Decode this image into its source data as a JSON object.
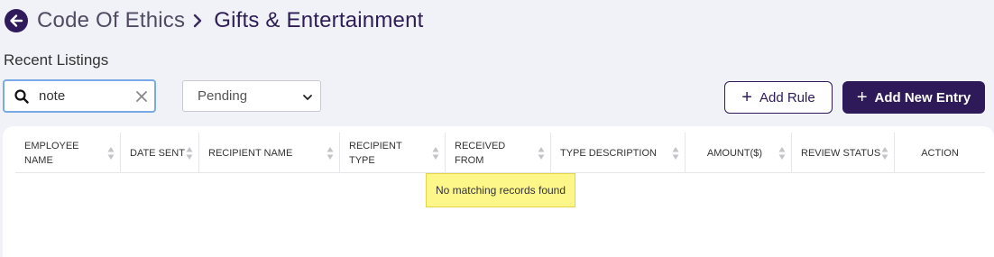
{
  "header": {
    "parent": "Code Of Ethics",
    "current": "Gifts & Entertainment"
  },
  "section_title": "Recent Listings",
  "filters": {
    "search_value": "note",
    "status_selected": "Pending"
  },
  "buttons": {
    "add_rule": "Add Rule",
    "add_new_entry": "Add New Entry"
  },
  "table": {
    "columns": [
      {
        "label": "EMPLOYEE NAME"
      },
      {
        "label": "DATE SENT"
      },
      {
        "label": "RECIPIENT NAME"
      },
      {
        "label": "RECIPIENT TYPE"
      },
      {
        "label": "RECEIVED FROM"
      },
      {
        "label": "TYPE DESCRIPTION"
      },
      {
        "label": "AMOUNT($)"
      },
      {
        "label": "REVIEW STATUS"
      },
      {
        "label": "ACTION"
      }
    ],
    "empty_message": "No matching records found"
  },
  "colors": {
    "brand": "#2e1a58",
    "background": "#f1f2f8",
    "empty_highlight": "#fdf78a"
  }
}
